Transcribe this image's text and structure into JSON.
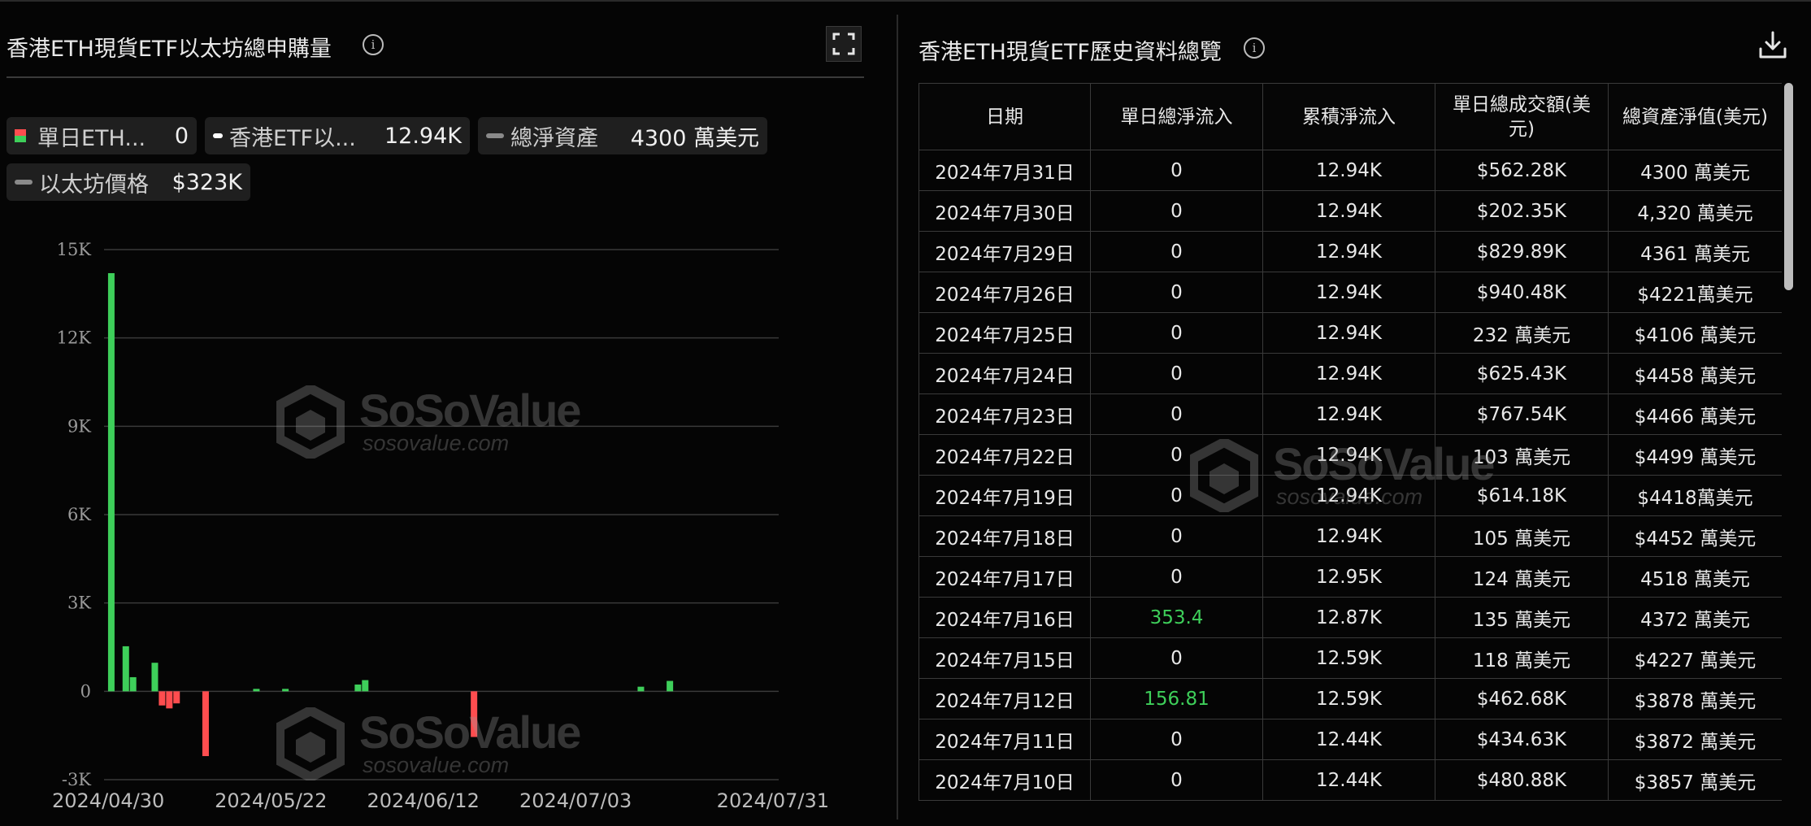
{
  "left_panel": {
    "title": "香港ETH現貨ETF以太坊總申購量",
    "legend": [
      {
        "label": "單日ETH...",
        "value": "0"
      },
      {
        "label": "香港ETF以...",
        "value": "12.94K"
      },
      {
        "label": "總淨資產",
        "value": "4300 萬美元"
      },
      {
        "label": "以太坊價格",
        "value": "$323K"
      }
    ]
  },
  "right_panel": {
    "title": "香港ETH現貨ETF歷史資料總覽",
    "columns": [
      "日期",
      "單日總淨流入",
      "累積淨流入",
      "單日總成交額(美元)",
      "總資產淨值(美元)"
    ],
    "rows": [
      [
        "2024年7月31日",
        "0",
        "12.94K",
        "$562.28K",
        "4300 萬美元"
      ],
      [
        "2024年7月30日",
        "0",
        "12.94K",
        "$202.35K",
        "4,320 萬美元"
      ],
      [
        "2024年7月29日",
        "0",
        "12.94K",
        "$829.89K",
        "4361 萬美元"
      ],
      [
        "2024年7月26日",
        "0",
        "12.94K",
        "$940.48K",
        "$4221萬美元"
      ],
      [
        "2024年7月25日",
        "0",
        "12.94K",
        "232 萬美元",
        "$4106 萬美元"
      ],
      [
        "2024年7月24日",
        "0",
        "12.94K",
        "$625.43K",
        "$4458 萬美元"
      ],
      [
        "2024年7月23日",
        "0",
        "12.94K",
        "$767.54K",
        "$4466 萬美元"
      ],
      [
        "2024年7月22日",
        "0",
        "12.94K",
        "103 萬美元",
        "$4499 萬美元"
      ],
      [
        "2024年7月19日",
        "0",
        "12.94K",
        "$614.18K",
        "$4418萬美元"
      ],
      [
        "2024年7月18日",
        "0",
        "12.94K",
        "105 萬美元",
        "$4452 萬美元"
      ],
      [
        "2024年7月17日",
        "0",
        "12.95K",
        "124 萬美元",
        "4518 萬美元"
      ],
      [
        "2024年7月16日",
        "353.4",
        "12.87K",
        "135 萬美元",
        "4372 萬美元"
      ],
      [
        "2024年7月15日",
        "0",
        "12.59K",
        "118 萬美元",
        "$4227 萬美元"
      ],
      [
        "2024年7月12日",
        "156.81",
        "12.59K",
        "$462.68K",
        "$3878 萬美元"
      ],
      [
        "2024年7月11日",
        "0",
        "12.44K",
        "$434.63K",
        "$3872 萬美元"
      ],
      [
        "2024年7月10日",
        "0",
        "12.44K",
        "$480.88K",
        "$3857 萬美元"
      ]
    ]
  },
  "watermark": {
    "brand": "SoSoValue",
    "url": "sosovalue.com"
  },
  "colors": {
    "positive": "#3ecf5a",
    "negative": "#ff4d4f",
    "background": "#050505"
  },
  "icons": {
    "info": "info-icon",
    "expand": "expand-icon",
    "download": "download-icon"
  },
  "chart_data": {
    "type": "bar",
    "y_tick_labels": [
      "15K",
      "12K",
      "9K",
      "6K",
      "3K",
      "0",
      "-3K"
    ],
    "x_tick_labels": [
      "2024/04/30",
      "2024/05/22",
      "2024/06/12",
      "2024/07/03",
      "2024/07/31"
    ],
    "ylim": [
      -3000,
      15000
    ],
    "grid": true,
    "x_range": [
      "2024-04-29",
      "2024-07-31"
    ],
    "series": [
      {
        "values": [
          {
            "date": "2024-04-30",
            "value": 14200
          },
          {
            "date": "2024-05-02",
            "value": 1530
          },
          {
            "date": "2024-05-03",
            "value": 480
          },
          {
            "date": "2024-05-06",
            "value": 970
          },
          {
            "date": "2024-05-07",
            "value": -480
          },
          {
            "date": "2024-05-08",
            "value": -580
          },
          {
            "date": "2024-05-09",
            "value": -410
          },
          {
            "date": "2024-05-13",
            "value": -2200
          },
          {
            "date": "2024-05-20",
            "value": 30
          },
          {
            "date": "2024-05-24",
            "value": 60
          },
          {
            "date": "2024-06-03",
            "value": 230
          },
          {
            "date": "2024-06-04",
            "value": 380
          },
          {
            "date": "2024-06-19",
            "value": -1550
          },
          {
            "date": "2024-07-12",
            "value": 156.81
          },
          {
            "date": "2024-07-16",
            "value": 353.4
          }
        ]
      }
    ]
  }
}
